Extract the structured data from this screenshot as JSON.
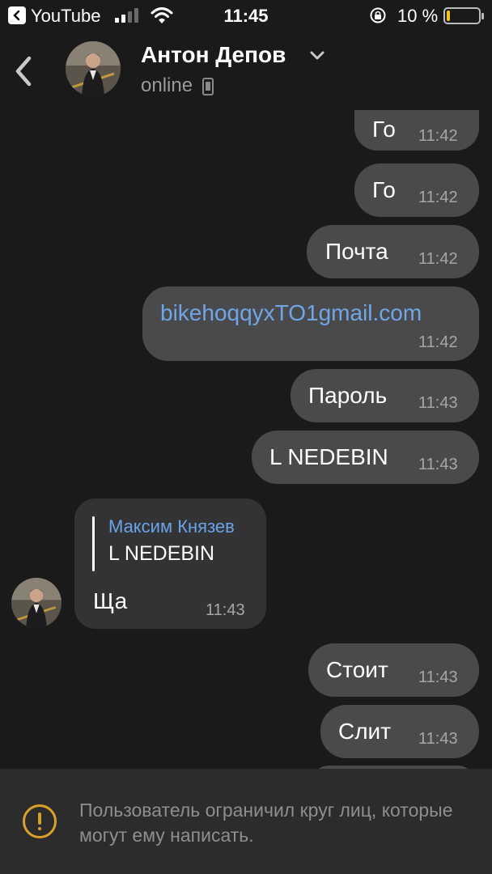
{
  "status_bar": {
    "back_app": "YouTube",
    "time": "11:45",
    "battery_percent": "10 %",
    "battery_level": 0.1,
    "signal_bars": 2
  },
  "header": {
    "contact_name": "Антон Депов",
    "status": "online"
  },
  "messages": [
    {
      "direction": "out",
      "text": "Го",
      "time": "11:42"
    },
    {
      "direction": "out",
      "text": "Го",
      "time": "11:42"
    },
    {
      "direction": "out",
      "text": "Почта",
      "time": "11:42"
    },
    {
      "direction": "out",
      "text": "bikehoqqyxTO1gmail.com",
      "time": "11:42",
      "is_link": true
    },
    {
      "direction": "out",
      "text": "Пароль",
      "time": "11:43"
    },
    {
      "direction": "out",
      "text": "L NEDEBIN",
      "time": "11:43"
    },
    {
      "direction": "in",
      "reply_author": "Максим Князев",
      "reply_text": "L NEDEBIN",
      "text": "Ща",
      "time": "11:43"
    },
    {
      "direction": "out",
      "text": "Стоит",
      "time": "11:43"
    },
    {
      "direction": "out",
      "text": "Слит",
      "time": "11:43"
    }
  ],
  "notice": {
    "text": "Пользователь ограничил круг лиц, которые могут ему написать.",
    "icon": "warning-icon"
  },
  "colors": {
    "background": "#1a1a1b",
    "outgoing_bubble": "#4a4a4c",
    "incoming_bubble": "#333335",
    "link": "#70a6e6",
    "reply_author": "#6aa3e8",
    "warning": "#d9a02a"
  }
}
